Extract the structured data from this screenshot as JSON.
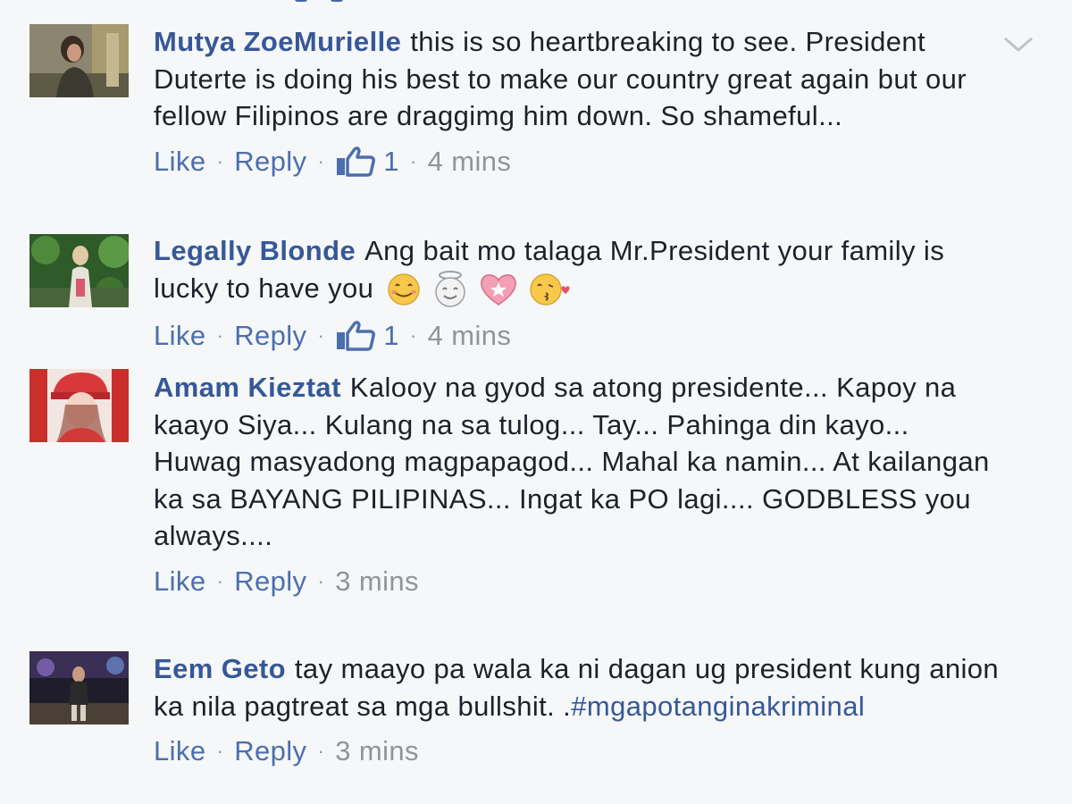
{
  "comments": [
    {
      "author": "Mutya ZoeMurielle",
      "text": "this is so heartbreaking to see. President Duterte is doing his best to make our country great again but our fellow Filipinos are draggimg him down. So shameful...",
      "actions": {
        "like": "Like",
        "reply": "Reply",
        "reaction_count": "1",
        "time": "4 mins"
      }
    },
    {
      "author": "Legally Blonde",
      "text": "Ang bait mo talaga Mr.President your family is lucky to have you",
      "emojis": [
        "smiling-face-emoji",
        "angel-face-emoji",
        "heart-star-emoji",
        "kissing-face-emoji"
      ],
      "actions": {
        "like": "Like",
        "reply": "Reply",
        "reaction_count": "1",
        "time": "4 mins"
      }
    },
    {
      "author": "Amam Kieztat",
      "text": "Kalooy na gyod sa atong presidente... Kapoy na kaayo Siya... Kulang na sa tulog... Tay... Pahinga din kayo... Huwag masyadong magpapagod... Mahal ka namin... At kailangan ka sa BAYANG PILIPINAS... Ingat ka PO lagi.... GODBLESS you always....",
      "actions": {
        "like": "Like",
        "reply": "Reply",
        "time": "3 mins"
      }
    },
    {
      "author": "Eem Geto",
      "text": "tay maayo pa wala ka ni dagan ug president kung anion ka nila pagtreat sa mga bullshit. .",
      "hashtag": "#mgapotanginakriminal",
      "actions": {
        "like": "Like",
        "reply": "Reply",
        "time": "3 mins"
      }
    }
  ],
  "colors": {
    "author": "#365899",
    "link": "#4b6fae",
    "meta": "#90949c",
    "background": "#f6f7f9"
  }
}
